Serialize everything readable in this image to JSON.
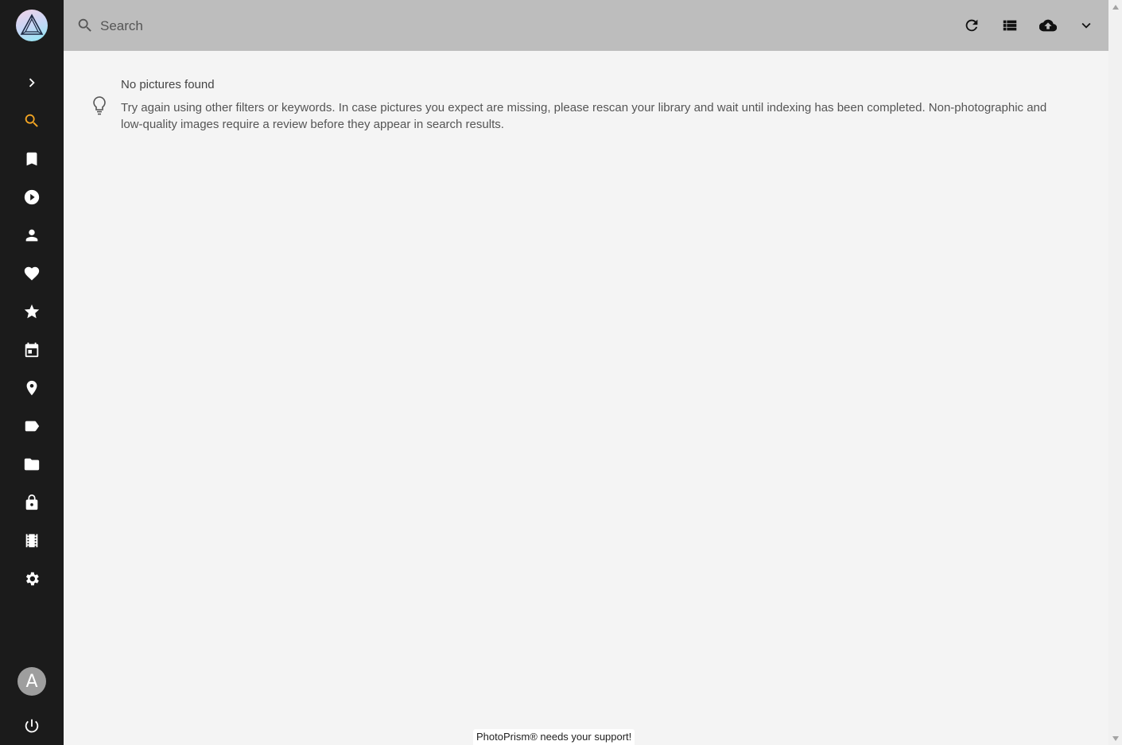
{
  "search": {
    "placeholder": "Search"
  },
  "sidebar": {
    "items": [
      {
        "name": "expand-sidebar-button",
        "icon": "chevron-right-icon"
      },
      {
        "name": "nav-search",
        "icon": "search-icon",
        "active": true
      },
      {
        "name": "nav-albums",
        "icon": "bookmark-icon"
      },
      {
        "name": "nav-videos",
        "icon": "play-circle-icon"
      },
      {
        "name": "nav-people",
        "icon": "person-icon"
      },
      {
        "name": "nav-favorites",
        "icon": "heart-icon"
      },
      {
        "name": "nav-moments",
        "icon": "star-icon"
      },
      {
        "name": "nav-calendar",
        "icon": "calendar-icon"
      },
      {
        "name": "nav-places",
        "icon": "map-pin-icon"
      },
      {
        "name": "nav-labels",
        "icon": "label-icon"
      },
      {
        "name": "nav-folders",
        "icon": "folder-icon"
      },
      {
        "name": "nav-private",
        "icon": "lock-icon"
      },
      {
        "name": "nav-library",
        "icon": "film-icon"
      },
      {
        "name": "nav-settings",
        "icon": "gear-icon"
      }
    ],
    "avatar_letter": "A",
    "accent_color": "#f5a623"
  },
  "toolbar": {
    "buttons": [
      "refresh-icon",
      "list-view-icon",
      "cloud-upload-icon",
      "chevron-down-icon"
    ]
  },
  "message": {
    "title": "No pictures found",
    "body": "Try again using other filters or keywords. In case pictures you expect are missing, please rescan your library and wait until indexing has been completed. Non-photographic and low-quality images require a review before they appear in search results.",
    "icon": "lightbulb-icon"
  },
  "footer": {
    "support_text": "PhotoPrism® needs your support!"
  }
}
